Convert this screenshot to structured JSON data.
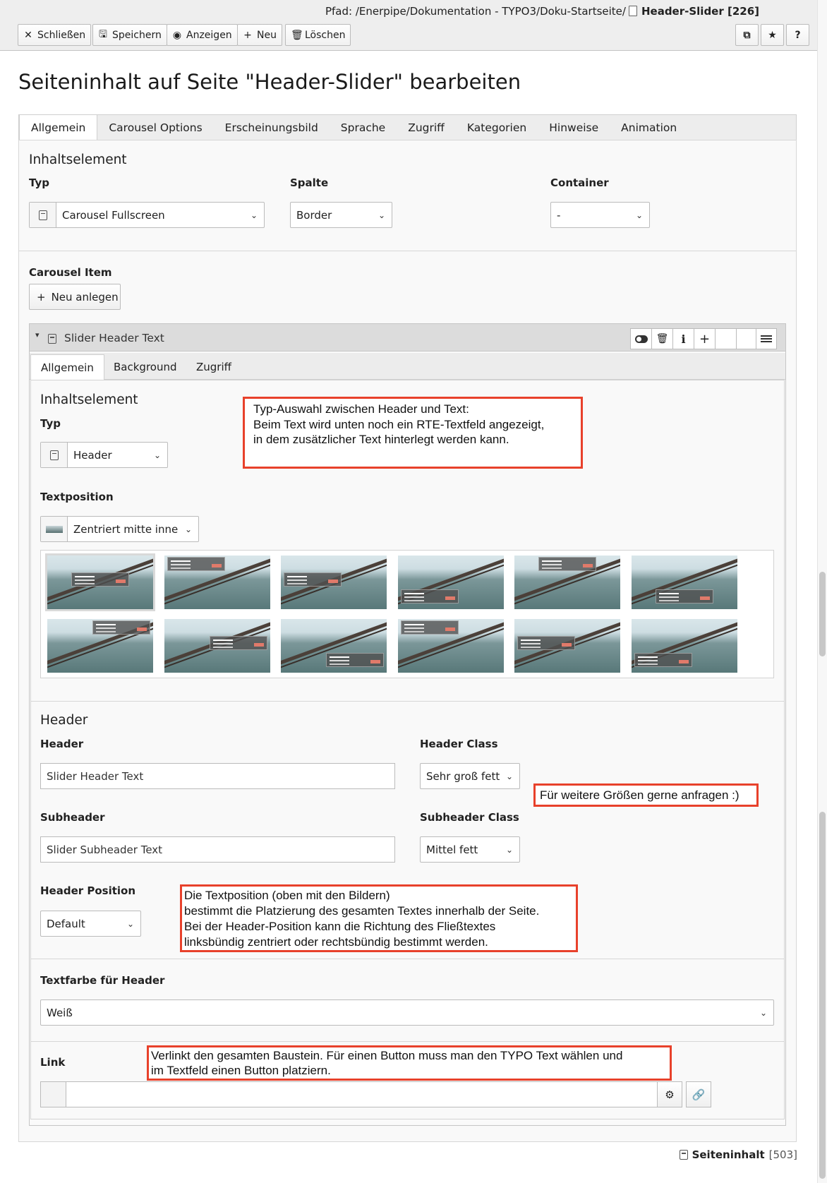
{
  "docheader": {
    "path_label": "Pfad:",
    "path_value": "/Enerpipe/Dokumentation - TYPO3/Doku-Startseite/",
    "record_title": "Header-Slider [226]",
    "buttons": {
      "close": "Schließen",
      "save": "Speichern",
      "view": "Anzeigen",
      "new": "Neu",
      "delete": "Löschen",
      "help": "?"
    }
  },
  "page_title": "Seiteninhalt auf Seite \"Header-Slider\" bearbeiten",
  "tabs": [
    "Allgemein",
    "Carousel Options",
    "Erscheinungsbild",
    "Sprache",
    "Zugriff",
    "Kategorien",
    "Hinweise",
    "Animation"
  ],
  "general": {
    "section_title": "Inhaltselement",
    "typ_label": "Typ",
    "typ_value": "Carousel Fullscreen",
    "spalte_label": "Spalte",
    "spalte_value": "Border",
    "container_label": "Container",
    "container_value": "-"
  },
  "carousel": {
    "label": "Carousel Item",
    "new_button": "Neu anlegen",
    "item_title": "Slider Header Text",
    "item_controls": {
      "info": "i",
      "add": "+"
    },
    "inner_tabs": [
      "Allgemein",
      "Background",
      "Zugriff"
    ],
    "section_title": "Inhaltselement",
    "typ_label": "Typ",
    "typ_value": "Header",
    "textposition_label": "Textposition",
    "textposition_value": "Zentriert mitte innen",
    "header_section": "Header",
    "header_label": "Header",
    "header_value": "Slider Header Text",
    "header_class_label": "Header Class",
    "header_class_value": "Sehr groß fett",
    "subheader_label": "Subheader",
    "subheader_value": "Slider Subheader Text",
    "subheader_class_label": "Subheader Class",
    "subheader_class_value": "Mittel fett",
    "header_position_label": "Header Position",
    "header_position_value": "Default",
    "textcolor_label": "Textfarbe für Header",
    "textcolor_value": "Weiß",
    "link_label": "Link",
    "link_value": ""
  },
  "notes": {
    "typ": [
      "Typ-Auswahl zwischen Header und Text:",
      "Beim Text wird unten noch ein RTE-Textfeld angezeigt,",
      "in dem zusätzlicher Text hinterlegt werden kann."
    ],
    "sizes": "Für weitere Größen gerne anfragen :)",
    "position": [
      "Die Textposition (oben mit den Bildern)",
      "bestimmt die Platzierung des gesamten Textes innerhalb der Seite.",
      "Bei der Header-Position kann die Richtung des Fließtextes",
      "linksbündig zentriert oder rechtsbündig bestimmt werden."
    ],
    "link": [
      "Verlinkt den gesamten Baustein. Für einen Button muss man den TYPO Text wählen und",
      "im Textfeld einen Button platziern."
    ]
  },
  "footer": {
    "record_type": "Seiteninhalt",
    "record_uid": "[503]"
  },
  "colors": {
    "annotation_border": "#e8412b",
    "tab_bar": "#ededed",
    "panel": "#f9f9f9"
  },
  "icons": [
    "close-icon",
    "save-icon",
    "view-icon",
    "plus-icon",
    "trash-icon",
    "open-new-window-icon",
    "star-icon",
    "help-icon",
    "toggle-icon",
    "info-icon",
    "handle-icon",
    "file-icon",
    "link-icon",
    "link-browser-icon",
    "chevron-down-icon"
  ]
}
